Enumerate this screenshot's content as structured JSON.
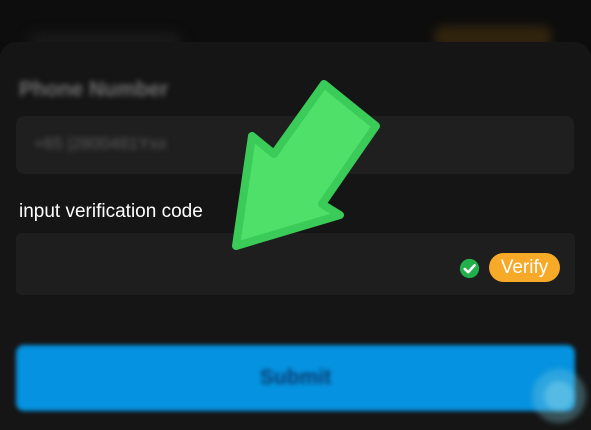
{
  "form": {
    "phone_label": "Phone Number",
    "phone_value": "+65 |2800481Yxx",
    "code_label": "input verification code",
    "code_value": "",
    "verify_label": "Verify",
    "submit_label": "Submit"
  },
  "icons": {
    "check": "check-circle-icon",
    "arrow": "arrow-pointer-icon",
    "help": "help-bubble-icon"
  },
  "colors": {
    "background": "#0c0c0c",
    "panel": "#151515",
    "input_bg": "#1e1e1e",
    "verify": "#f7a928",
    "submit": "#0592e0",
    "check": "#22b04b",
    "arrow": "#4fe06a"
  }
}
